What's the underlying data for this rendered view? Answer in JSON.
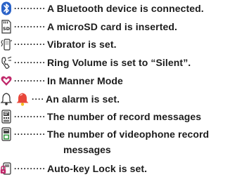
{
  "items": [
    {
      "icon": "bluetooth-icon",
      "dots": "··········",
      "text": "A Bluetooth device is connected."
    },
    {
      "icon": "microsd-card-icon",
      "dots": "··········",
      "text": "A microSD card is inserted."
    },
    {
      "icon": "vibrator-icon",
      "dots": "··········",
      "text": "Vibrator is set."
    },
    {
      "icon": "ring-volume-silent-icon",
      "dots": "··········",
      "text": "Ring Volume is set to “Silent”."
    },
    {
      "icon": "manner-mode-icon",
      "dots": "··········",
      "text": "In Manner Mode"
    },
    {
      "icon": "alarm-bell-icon",
      "icon2": "alarm-color-icon",
      "dots": "····",
      "text": "An alarm is set."
    },
    {
      "icon": "record-messages-icon",
      "dots": "··········",
      "text": "The number of record messages"
    },
    {
      "icon": "videophone-record-icon",
      "dots": "··········",
      "text": "The number of videophone record",
      "continuation": "messages"
    },
    {
      "icon": "auto-key-lock-icon",
      "dots": "··········",
      "text": "Auto-key Lock is set."
    }
  ],
  "colors": {
    "bluetooth_bg": "#2a62c8",
    "manner_heart": "#c0286a",
    "alarm_red": "#e8463a",
    "alarm_yellow": "#f2c020",
    "record_green": "#2f9a3c"
  }
}
